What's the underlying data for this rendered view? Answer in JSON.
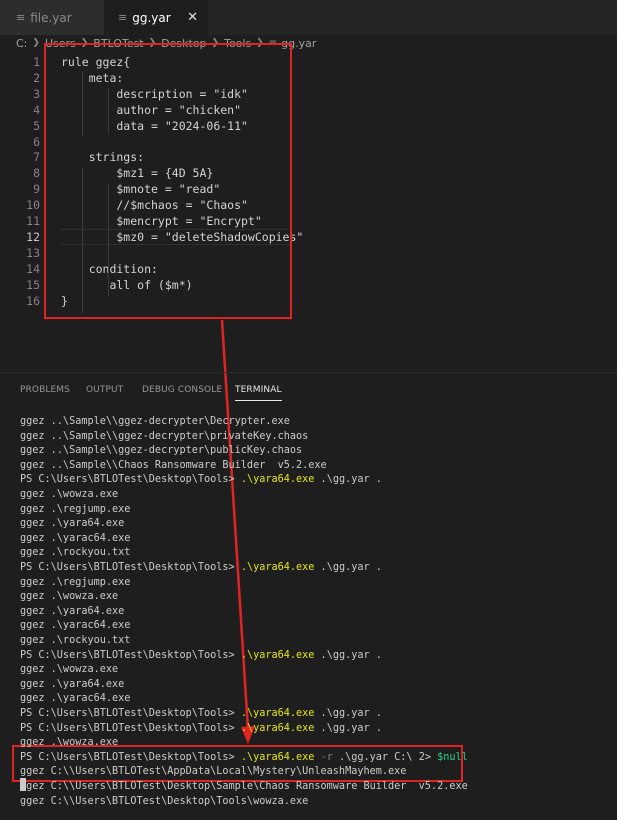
{
  "tabs": [
    {
      "label": "file.yar",
      "icon": "file-lines-icon",
      "active": false
    },
    {
      "label": "gg.yar",
      "icon": "file-lines-icon",
      "active": true,
      "close": "✕"
    }
  ],
  "breadcrumb": [
    "C:",
    "Users",
    "BTLOTest",
    "Desktop",
    "Tools",
    "gg.yar"
  ],
  "editor": {
    "current_line": 12,
    "lines": [
      {
        "n": "1",
        "text": "rule ggez{"
      },
      {
        "n": "2",
        "text": "    meta:"
      },
      {
        "n": "3",
        "text": "        description = \"idk\""
      },
      {
        "n": "4",
        "text": "        author = \"chicken\""
      },
      {
        "n": "5",
        "text": "        data = \"2024-06-11\""
      },
      {
        "n": "6",
        "text": ""
      },
      {
        "n": "7",
        "text": "    strings:"
      },
      {
        "n": "8",
        "text": "        $mz1 = {4D 5A}"
      },
      {
        "n": "9",
        "text": "        $mnote = \"read\""
      },
      {
        "n": "10",
        "text": "        //$mchaos = \"Chaos\""
      },
      {
        "n": "11",
        "text": "        $mencrypt = \"Encrypt\""
      },
      {
        "n": "12",
        "text": "        $mz0 = \"deleteShadowCopies\""
      },
      {
        "n": "13",
        "text": ""
      },
      {
        "n": "14",
        "text": "    condition:"
      },
      {
        "n": "15",
        "text": "       all of ($m*)"
      },
      {
        "n": "16",
        "text": "}"
      }
    ]
  },
  "panel_tabs": [
    {
      "label": "PROBLEMS",
      "active": false
    },
    {
      "label": "OUTPUT",
      "active": false
    },
    {
      "label": "DEBUG CONSOLE",
      "active": false
    },
    {
      "label": "TERMINAL",
      "active": true
    }
  ],
  "terminal": {
    "prompt": "PS C:\\Users\\BTLOTest\\Desktop\\Tools>",
    "colors": {
      "command": "#e5e510",
      "flag": "#808080",
      "variable": "#23d18b",
      "highlight_box": "#e02424"
    },
    "lines": [
      {
        "type": "out",
        "text": "ggez ..\\Sample\\\\ggez-decrypter\\Decrypter.exe"
      },
      {
        "type": "out",
        "text": "ggez ..\\Sample\\\\ggez-decrypter\\privateKey.chaos"
      },
      {
        "type": "out",
        "text": "ggez ..\\Sample\\\\ggez-decrypter\\publicKey.chaos"
      },
      {
        "type": "out",
        "text": "ggez ..\\Sample\\\\Chaos Ransomware Builder  v5.2.exe"
      },
      {
        "type": "cmd",
        "cmd": ".\\yara64.exe",
        "args": " .\\gg.yar ."
      },
      {
        "type": "out",
        "text": "ggez .\\wowza.exe"
      },
      {
        "type": "out",
        "text": "ggez .\\regjump.exe"
      },
      {
        "type": "out",
        "text": "ggez .\\yara64.exe"
      },
      {
        "type": "out",
        "text": "ggez .\\yarac64.exe"
      },
      {
        "type": "out",
        "text": "ggez .\\rockyou.txt"
      },
      {
        "type": "cmd",
        "cmd": ".\\yara64.exe",
        "args": " .\\gg.yar ."
      },
      {
        "type": "out",
        "text": "ggez .\\regjump.exe"
      },
      {
        "type": "out",
        "text": "ggez .\\wowza.exe"
      },
      {
        "type": "out",
        "text": "ggez .\\yara64.exe"
      },
      {
        "type": "out",
        "text": "ggez .\\yarac64.exe"
      },
      {
        "type": "out",
        "text": "ggez .\\rockyou.txt"
      },
      {
        "type": "cmd",
        "cmd": ".\\yara64.exe",
        "args": " .\\gg.yar ."
      },
      {
        "type": "out",
        "text": "ggez .\\wowza.exe"
      },
      {
        "type": "out",
        "text": "ggez .\\yara64.exe"
      },
      {
        "type": "out",
        "text": "ggez .\\yarac64.exe"
      },
      {
        "type": "cmd",
        "cmd": ".\\yara64.exe",
        "args": " .\\gg.yar ."
      },
      {
        "type": "cmd",
        "cmd": ".\\yara64.exe",
        "args": " .\\gg.yar ."
      },
      {
        "type": "out",
        "text": "ggez .\\wowza.exe"
      },
      {
        "type": "cmd",
        "cmd": ".\\yara64.exe",
        "flag": " -r",
        "args": " .\\gg.yar C:\\ 2> ",
        "var": "$null"
      },
      {
        "type": "out",
        "text": "ggez C:\\\\Users\\BTLOTest\\AppData\\Local\\Mystery\\UnleashMayhem.exe"
      },
      {
        "type": "out",
        "text": "ggez C:\\\\Users\\BTLOTest\\Desktop\\Sample\\Chaos Ransomware Builder  v5.2.exe"
      },
      {
        "type": "out",
        "text": "ggez C:\\\\Users\\BTLOTest\\Desktop\\Tools\\wowza.exe"
      }
    ]
  }
}
